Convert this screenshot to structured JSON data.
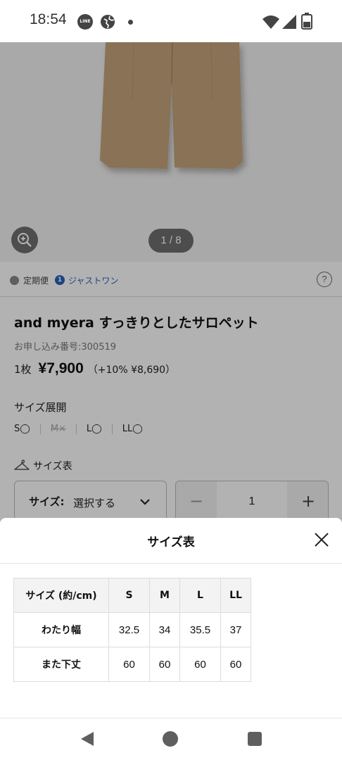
{
  "status_bar": {
    "time": "18:54",
    "icons": [
      "line-icon",
      "globe-icon",
      "dot-icon",
      "wifi-icon",
      "signal-icon",
      "battery-icon"
    ]
  },
  "product": {
    "image_pager": "1 / 8",
    "services": {
      "teiki": "定期便",
      "just_one": "ジャストワン"
    },
    "title": "and myera すっきりとしたサロペット",
    "order_number": "お申し込み番号:300519",
    "quantity_unit": "1枚",
    "price": "¥7,900",
    "price_tax": "（+10% ¥8,690）",
    "size_heading": "サイズ展開",
    "size_availability": [
      {
        "label": "S◯",
        "available": true
      },
      {
        "label": "M×",
        "available": false
      },
      {
        "label": "L◯",
        "available": true
      },
      {
        "label": "LL◯",
        "available": true
      }
    ],
    "size_chart_link": "サイズ表",
    "size_select": {
      "label": "サイズ:",
      "value": "選択する"
    },
    "quantity": {
      "minus": "−",
      "value": "1",
      "plus": "+"
    }
  },
  "size_sheet": {
    "title": "サイズ表",
    "table": {
      "header": [
        "サイズ (約/cm)",
        "S",
        "M",
        "L",
        "LL"
      ],
      "rows": [
        {
          "label": "わたり幅",
          "values": [
            "32.5",
            "34",
            "35.5",
            "37"
          ]
        },
        {
          "label": "また下丈",
          "values": [
            "60",
            "60",
            "60",
            "60"
          ]
        }
      ]
    }
  },
  "colors": {
    "accent_blue": "#2a62b8",
    "pants": "#c4a47a"
  }
}
